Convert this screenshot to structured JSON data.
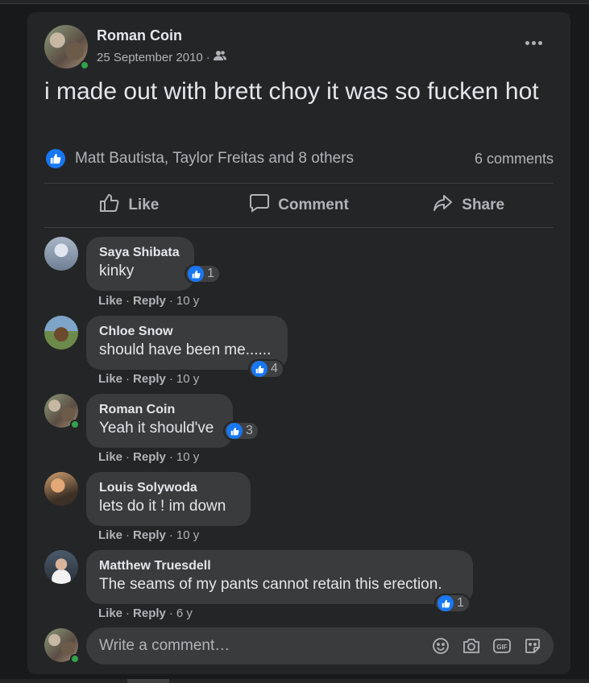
{
  "post": {
    "author": "Roman Coin",
    "date": "25 September 2010",
    "separator": "·",
    "text": "i made out with brett choy it was so fucken hot",
    "reactions_text": "Matt Bautista, Taylor Freitas and 8 others",
    "comments_count": "6 comments"
  },
  "actions": {
    "like": "Like",
    "comment": "Comment",
    "share": "Share"
  },
  "comments": [
    {
      "name": "Saya Shibata",
      "text": "kinky",
      "likes": "1",
      "like": "Like",
      "reply": "Reply",
      "age": "10 y",
      "sep": "·"
    },
    {
      "name": "Chloe Snow",
      "text": "should have been me......",
      "likes": "4",
      "like": "Like",
      "reply": "Reply",
      "age": "10 y",
      "sep": "·"
    },
    {
      "name": "Roman Coin",
      "text": "Yeah it should've",
      "likes": "3",
      "like": "Like",
      "reply": "Reply",
      "age": "10 y",
      "sep": "·"
    },
    {
      "name": "Louis Solywoda",
      "text": "lets do it ! im down",
      "like": "Like",
      "reply": "Reply",
      "age": "10 y",
      "sep": "·"
    },
    {
      "name": "Matthew Truesdell",
      "text": "The seams of my pants cannot retain this erection.",
      "likes": "1",
      "like": "Like",
      "reply": "Reply",
      "age": "6 y",
      "sep": "·"
    }
  ],
  "composer": {
    "placeholder": "Write a comment…"
  },
  "icons": [
    "friends-audience-icon",
    "more-options-icon",
    "like-thumb-icon",
    "comment-bubble-icon",
    "share-arrow-icon",
    "emoji-icon",
    "camera-icon",
    "gif-icon",
    "sticker-icon"
  ],
  "colors": {
    "background": "#18191a",
    "card": "#242526",
    "bubble": "#3a3b3c",
    "accent": "#1877f2",
    "online": "#31a24c",
    "secondary_text": "#b0b3b8"
  }
}
